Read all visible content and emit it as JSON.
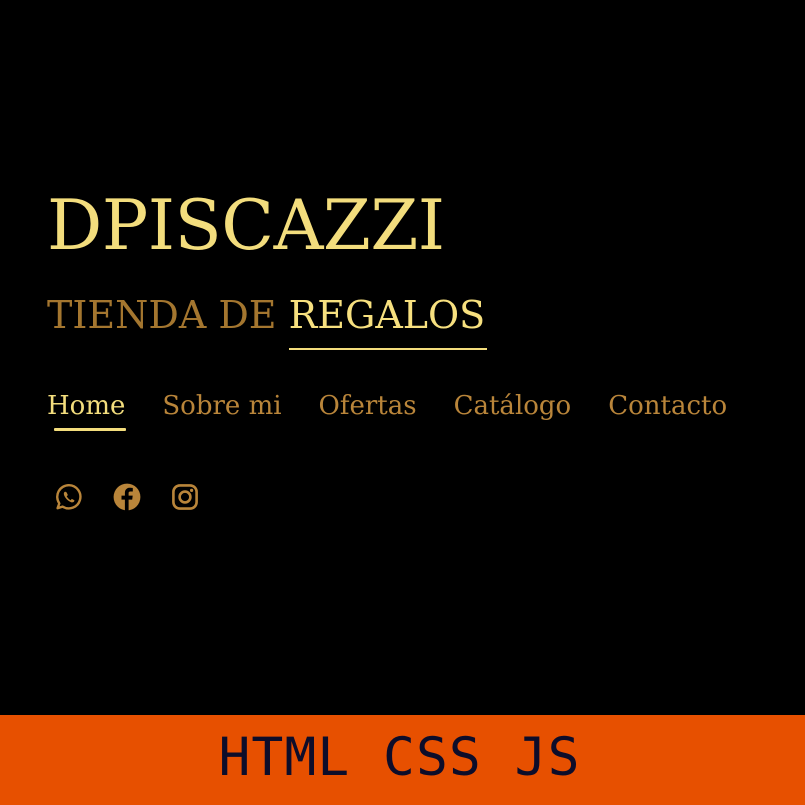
{
  "brand": {
    "title": "DPISCAZZI",
    "tagline_prefix": "TIENDA DE ",
    "tagline_highlight": "REGALOS"
  },
  "nav": {
    "items": [
      {
        "label": "Home",
        "active": true
      },
      {
        "label": "Sobre mi",
        "active": false
      },
      {
        "label": "Ofertas",
        "active": false
      },
      {
        "label": "Catálogo",
        "active": false
      },
      {
        "label": "Contacto",
        "active": false
      }
    ]
  },
  "social": {
    "icons": [
      "whatsapp-icon",
      "facebook-icon",
      "instagram-icon"
    ]
  },
  "banner": {
    "text": "HTML CSS JS"
  },
  "colors": {
    "background": "#000000",
    "brand_gold": "#f3dd7d",
    "muted_gold": "#b9853a",
    "banner_orange": "#e75000",
    "banner_text": "#0d0d2a"
  }
}
